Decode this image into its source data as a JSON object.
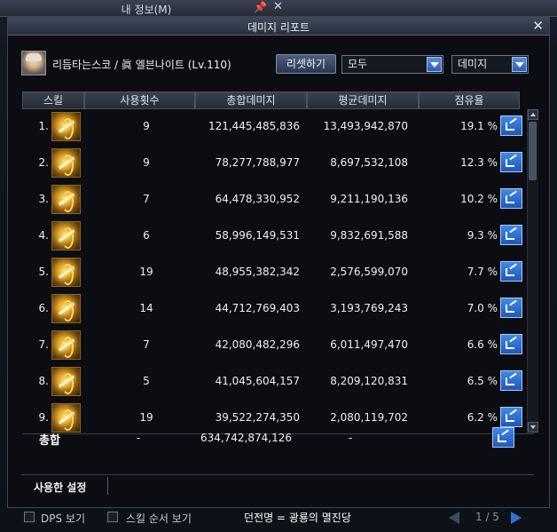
{
  "outer": {
    "title": "내 정보(M)"
  },
  "window": {
    "title": "데미지 리포트",
    "close": "✕"
  },
  "character": {
    "name": "리듬타는스코 / 眞 엘븐나이트 (Lv.110)"
  },
  "controls": {
    "reset_label": "리셋하기",
    "filter1": "모두",
    "filter2": "데미지"
  },
  "columns": [
    "스킬",
    "사용횟수",
    "총합데미지",
    "평균데미지",
    "점유율"
  ],
  "rows": [
    {
      "rank": "1.",
      "count": "9",
      "total": "121,445,485,836",
      "avg": "13,493,942,870",
      "pct": "19.1 %"
    },
    {
      "rank": "2.",
      "count": "9",
      "total": "78,277,788,977",
      "avg": "8,697,532,108",
      "pct": "12.3 %"
    },
    {
      "rank": "3.",
      "count": "7",
      "total": "64,478,330,952",
      "avg": "9,211,190,136",
      "pct": "10.2 %"
    },
    {
      "rank": "4.",
      "count": "6",
      "total": "58,996,149,531",
      "avg": "9,832,691,588",
      "pct": "9.3 %"
    },
    {
      "rank": "5.",
      "count": "19",
      "total": "48,955,382,342",
      "avg": "2,576,599,070",
      "pct": "7.7 %"
    },
    {
      "rank": "6.",
      "count": "14",
      "total": "44,712,769,403",
      "avg": "3,193,769,243",
      "pct": "7.0 %"
    },
    {
      "rank": "7.",
      "count": "7",
      "total": "42,080,482,296",
      "avg": "6,011,497,470",
      "pct": "6.6 %"
    },
    {
      "rank": "8.",
      "count": "5",
      "total": "41,045,604,157",
      "avg": "8,209,120,831",
      "pct": "6.5 %"
    },
    {
      "rank": "9.",
      "count": "19",
      "total": "39,522,274,350",
      "avg": "2,080,119,702",
      "pct": "6.2 %"
    }
  ],
  "total": {
    "label": "총합",
    "count": "-",
    "total": "634,742,874,126",
    "avg": "-"
  },
  "settings": {
    "label": "사용한 설정"
  },
  "footer": {
    "dps_label": "DPS 보기",
    "skill_order_label": "스킬 순서 보기",
    "dungeon": "던전명 = 광룡의 멸진당",
    "page": "1 / 5"
  },
  "colors": {
    "accent_blue": "#2f6fd0",
    "header_bg": "#2e3440"
  },
  "icons": [
    "close-icon",
    "share-icon",
    "dropdown-arrow-icon",
    "scroll-up-icon",
    "scroll-down-icon",
    "prev-page-icon",
    "next-page-icon"
  ]
}
